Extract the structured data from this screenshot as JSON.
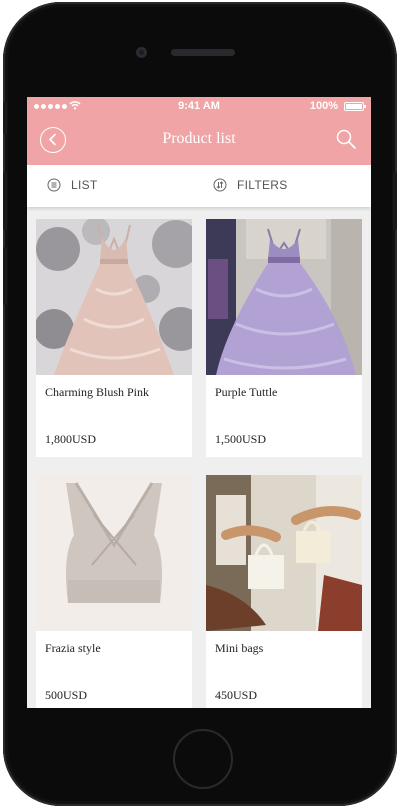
{
  "status": {
    "time": "9:41 AM",
    "battery": "100%"
  },
  "header": {
    "title": "Product list"
  },
  "toolbar": {
    "list_label": "LIST",
    "filters_label": "FILTERS"
  },
  "products": [
    {
      "name": "Charming Blush Pink",
      "price": "1,800USD",
      "image": "blush-pink-gown-photo"
    },
    {
      "name": "Purple Tuttle",
      "price": "1,500USD",
      "image": "purple-tulle-gown-photo"
    },
    {
      "name": "Frazia style",
      "price": "500USD",
      "image": "crossback-crop-top-photo"
    },
    {
      "name": "Mini bags",
      "price": "450USD",
      "image": "white-mini-bags-photo"
    }
  ],
  "colors": {
    "accent": "#f0a4a5",
    "background": "#efefef",
    "card": "#ffffff"
  }
}
